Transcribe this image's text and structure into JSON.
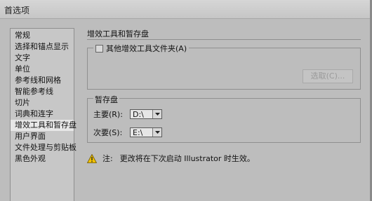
{
  "window": {
    "title": "首选项"
  },
  "sidebar": {
    "items": [
      {
        "label": "常规"
      },
      {
        "label": "选择和锚点显示"
      },
      {
        "label": "文字"
      },
      {
        "label": "单位"
      },
      {
        "label": "参考线和网格"
      },
      {
        "label": "智能参考线"
      },
      {
        "label": "切片"
      },
      {
        "label": "词典和连字"
      },
      {
        "label": "增效工具和暂存盘",
        "selected": true
      },
      {
        "label": "用户界面"
      },
      {
        "label": "文件处理与剪贴板"
      },
      {
        "label": "黑色外观"
      }
    ]
  },
  "main": {
    "section_title": "增效工具和暂存盘",
    "plugins": {
      "checkbox_label": "其他增效工具文件夹(A)",
      "checked": false,
      "choose_button": "选取(C)..."
    },
    "scratch": {
      "group_label": "暂存盘",
      "primary_label": "主要(R):",
      "primary_value": "D:\\",
      "secondary_label": "次要(S):",
      "secondary_value": "E:\\"
    },
    "note": {
      "icon": "warning-icon",
      "label": "注:",
      "text": "更改将在下次启动 Illustrator 时生效。"
    }
  },
  "colors": {
    "background": "#bdbdbd",
    "selected_item": "#e7e7e7",
    "border": "#8f8f8f",
    "warning_fill": "#f2c200"
  }
}
